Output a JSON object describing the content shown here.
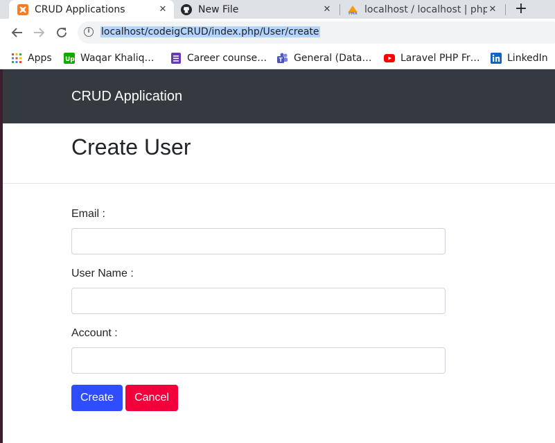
{
  "browser": {
    "tabs": [
      {
        "title": "CRUD Applications",
        "active": true,
        "icon": "xampp-icon"
      },
      {
        "title": "New File",
        "active": false,
        "icon": "github-icon"
      },
      {
        "title": "localhost / localhost | php",
        "active": false,
        "icon": "phpmyadmin-icon"
      }
    ],
    "url": "localhost/codeigCRUD/index.php/User/create",
    "bookmarks": [
      {
        "label": "Apps",
        "icon": "apps-grid-icon"
      },
      {
        "label": "Waqar Khaliq…",
        "icon": "upwork-icon"
      },
      {
        "label": "Career counse…",
        "icon": "forms-icon"
      },
      {
        "label": "General (Data…",
        "icon": "teams-icon"
      },
      {
        "label": "Laravel PHP Fr…",
        "icon": "youtube-icon"
      },
      {
        "label": "LinkedIn",
        "icon": "linkedin-icon"
      }
    ]
  },
  "app": {
    "brand": "CRUD Application",
    "page_title": "Create User",
    "form": {
      "email_label": "Email :",
      "email_value": "",
      "username_label": "User Name :",
      "username_value": "",
      "account_label": "Account :",
      "account_value": "",
      "create_button": "Create",
      "cancel_button": "Cancel"
    }
  },
  "colors": {
    "navbar": "#343a40",
    "primary": "#2d4dff",
    "danger": "#f2003c"
  }
}
